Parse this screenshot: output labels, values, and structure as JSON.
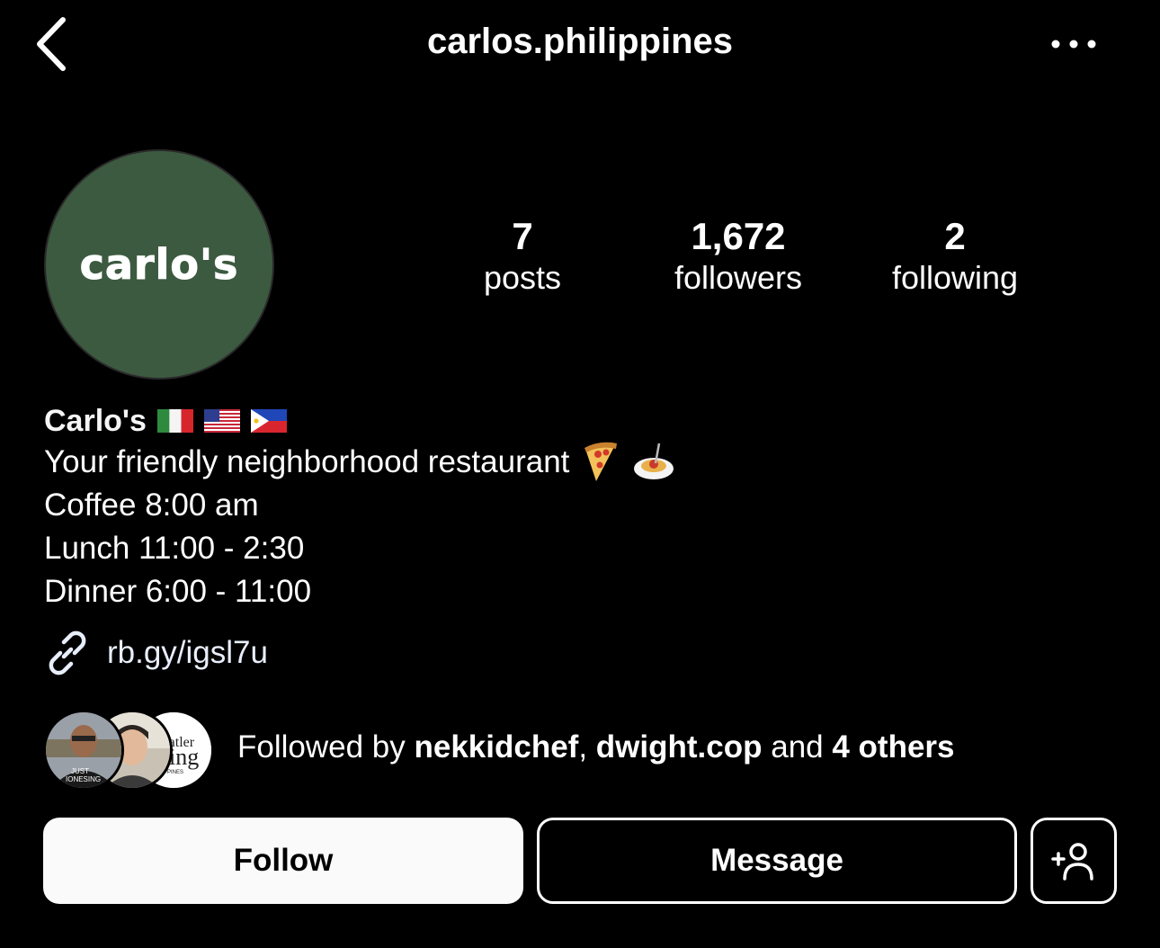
{
  "header": {
    "username": "carlos.philippines",
    "back_icon": "chevron-left-icon",
    "more_icon": "more-horizontal-icon"
  },
  "profile": {
    "avatar_text": "carlo's",
    "avatar_bg": "#3c5a40",
    "stats": [
      {
        "value": "7",
        "label": "posts"
      },
      {
        "value": "1,672",
        "label": "followers"
      },
      {
        "value": "2",
        "label": "following"
      }
    ]
  },
  "bio": {
    "display_name": "Carlo's",
    "flags": [
      "italy-flag-icon",
      "usa-flag-icon",
      "philippines-flag-icon"
    ],
    "line1": "Your friendly neighborhood restaurant",
    "line1_emojis": [
      "pizza-icon",
      "spaghetti-icon"
    ],
    "line2": "Coffee 8:00 am",
    "line3": "Lunch 11:00 - 2:30",
    "line4": "Dinner 6:00 - 11:00",
    "link": "rb.gy/igsl7u"
  },
  "followed_by": {
    "prefix": "Followed by ",
    "user1": "nekkidchef",
    "sep": ", ",
    "user2": "dwight.cop",
    "and": " and ",
    "others": "4 others",
    "avatar3_text_1": "Tatler",
    "avatar3_text_2": "ning",
    "avatar3_text_3": "LIPPINES",
    "avatar1_shirt_text_1": "JUST",
    "avatar1_shirt_text_2": "IONESING"
  },
  "buttons": {
    "follow": "Follow",
    "message": "Message",
    "suggest_icon": "add-person-icon"
  },
  "colors": {
    "background": "#000000",
    "avatar_green": "#3c5a40",
    "follow_button_bg": "#fafafa"
  }
}
